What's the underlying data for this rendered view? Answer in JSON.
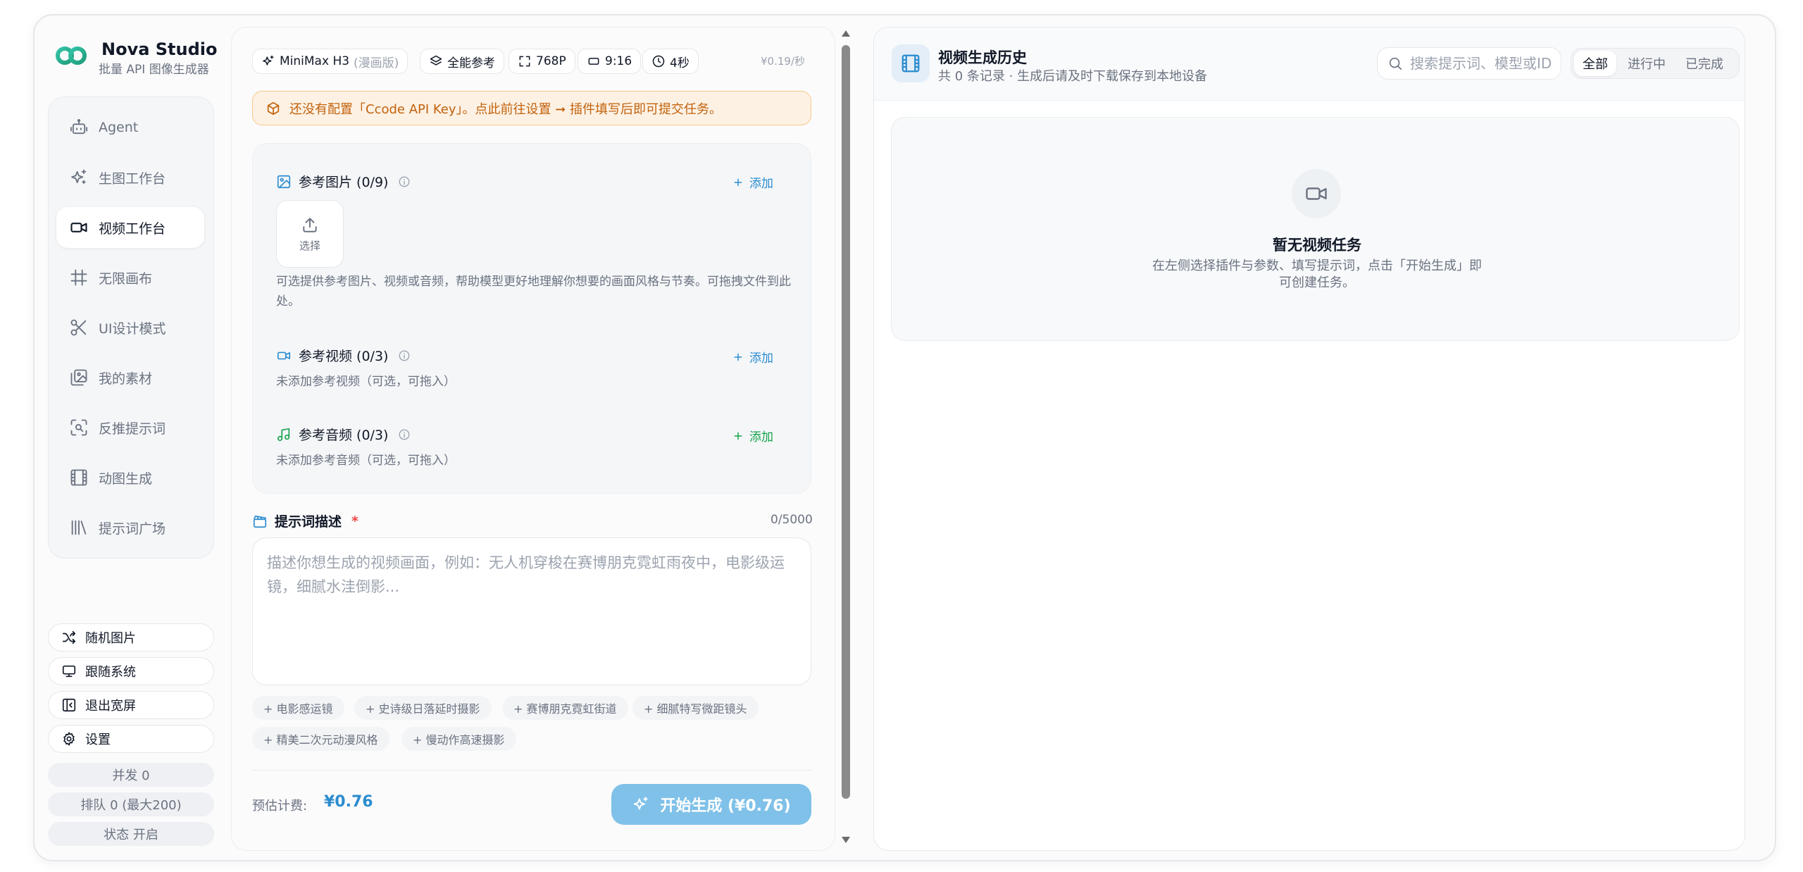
{
  "brand": {
    "title": "Nova Studio",
    "subtitle": "批量 API 图像生成器"
  },
  "nav": [
    {
      "label": "Agent",
      "icon": "robot-icon",
      "active": false
    },
    {
      "label": "生图工作台",
      "icon": "sparkles-icon",
      "active": false
    },
    {
      "label": "视频工作台",
      "icon": "video-camera-icon",
      "active": true
    },
    {
      "label": "无限画布",
      "icon": "hash-grid-icon",
      "active": false
    },
    {
      "label": "UI设计模式",
      "icon": "scissors-icon",
      "active": false
    },
    {
      "label": "我的素材",
      "icon": "image-library-icon",
      "active": false
    },
    {
      "label": "反推提示词",
      "icon": "scan-search-icon",
      "active": false
    },
    {
      "label": "动图生成",
      "icon": "film-icon",
      "active": false
    },
    {
      "label": "提示词广场",
      "icon": "books-icon",
      "active": false
    }
  ],
  "utilities": [
    {
      "label": "随机图片",
      "icon": "shuffle-icon"
    },
    {
      "label": "跟随系统",
      "icon": "monitor-icon"
    },
    {
      "label": "退出宽屏",
      "icon": "collapse-icon"
    },
    {
      "label": "设置",
      "icon": "gear-icon"
    }
  ],
  "stats": {
    "concurrency": "并发 0",
    "queue": "排队 0 (最大200)",
    "status": "状态 开启"
  },
  "toolbar": {
    "model": "MiniMax H3",
    "model_variant": "(漫画版)",
    "reference_mode": "全能参考",
    "resolution": "768P",
    "ratio": "9:16",
    "duration": "4秒",
    "price_rate": "¥0.19/秒"
  },
  "warning": "还没有配置「Ccode API Key」。点此前往设置 ➞ 插件填写后即可提交任务。",
  "references": {
    "image": {
      "title": "参考图片 (0/9)",
      "add": "添加",
      "upload": "选择",
      "hint_line1": "可选提供参考图片、视频或音频，帮助模型更好地理解你想要的画面风格与节奏。可拖拽文件到此",
      "hint_line2": "处。"
    },
    "video": {
      "title": "参考视频 (0/3)",
      "add": "添加",
      "hint": "未添加参考视频（可选，可拖入）"
    },
    "audio": {
      "title": "参考音频 (0/3)",
      "add": "添加",
      "hint": "未添加参考音频（可选，可拖入）"
    }
  },
  "prompt": {
    "label": "提示词描述",
    "required_mark": "*",
    "counter": "0/5000",
    "value": "",
    "placeholder": "描述你想生成的视频画面，例如：无人机穿梭在赛博朋克霓虹雨夜中，电影级运镜，细腻水洼倒影..."
  },
  "tags": [
    "+ 电影感运镜",
    "+ 史诗级日落延时摄影",
    "+ 赛博朋克霓虹街道",
    "+ 细腻特写微距镜头",
    "+ 精美二次元动漫风格",
    "+ 慢动作高速摄影"
  ],
  "cost": {
    "label": "预估计费:",
    "value": "¥0.76",
    "button": "开始生成 (¥0.76)"
  },
  "history": {
    "title": "视频生成历史",
    "subtitle": "共 0 条记录 · 生成后请及时下载保存到本地设备",
    "search_placeholder": "搜索提示词、模型或ID",
    "filters": [
      {
        "label": "全部",
        "active": true
      },
      {
        "label": "进行中",
        "active": false
      },
      {
        "label": "已完成",
        "active": false
      }
    ],
    "empty_title": "暂无视频任务",
    "empty_desc_line1": "在左侧选择插件与参数、填写提示词，点击「开始生成」即",
    "empty_desc_line2": "可创建任务。"
  },
  "colors": {
    "accent": "#2b8ccf",
    "generate_button": "#7fc1e8",
    "warning_text": "#c2620b",
    "warning_bg": "#fdf1e4",
    "audio_add": "#16a34a"
  }
}
